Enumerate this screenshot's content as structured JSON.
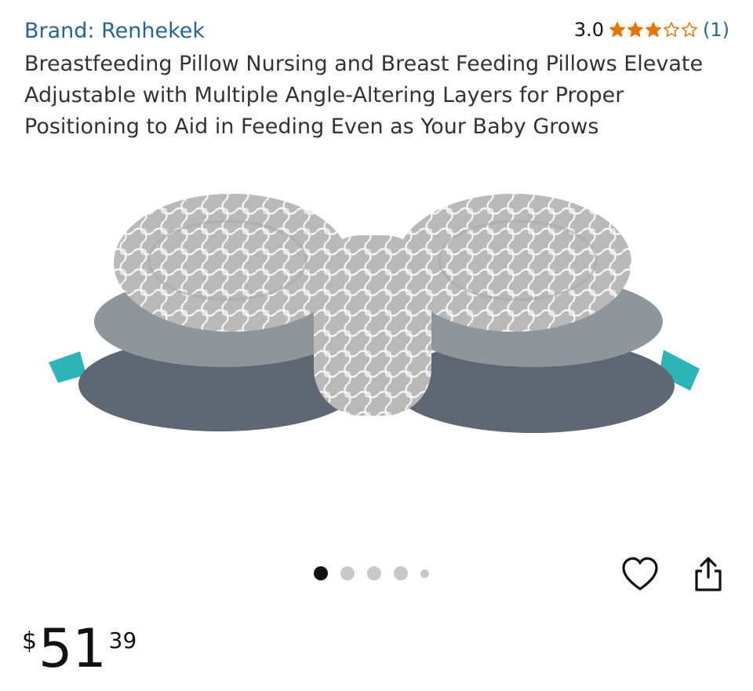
{
  "product": {
    "brand_link": "Brand: Renhekek",
    "rating_value": "3.0",
    "rating_stars": 3,
    "rating_max": 5,
    "rating_count": "(1)",
    "title": "Breastfeeding Pillow Nursing and Breast Feeding Pillows Elevate Adjustable with Multiple Angle-Altering Layers for Proper Positioning to Aid in Feeding Even as Your Baby Grows"
  },
  "gallery": {
    "image_count": 5,
    "active_index": 0
  },
  "actions": {
    "favorite_icon": "heart-outline-icon",
    "share_icon": "share-icon"
  },
  "price": {
    "currency": "$",
    "whole": "51",
    "cents": "39"
  },
  "colors": {
    "brand_link": "#2a6496",
    "star": "#e77600",
    "pillow_pattern": "#b9b9b9",
    "pillow_mid": "#8e959b",
    "pillow_bottom": "#5f6872",
    "tab_teal": "#2bb5b8"
  }
}
